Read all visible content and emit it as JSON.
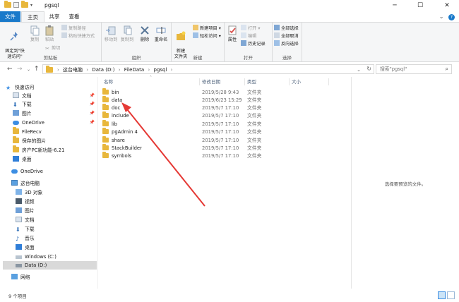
{
  "window": {
    "title": "pgsql",
    "controls": {
      "minimize": "─",
      "maximize": "☐",
      "close": "✕"
    }
  },
  "ribbon_tabs": [
    "文件",
    "主页",
    "共享",
    "查看"
  ],
  "ribbon": {
    "clipboard": {
      "label": "剪贴板",
      "pin_quick": "固定到\"快\n速访问\"",
      "copy": "复制",
      "paste": "粘贴",
      "copy_path": "复制路径",
      "paste_shortcut": "粘贴快捷方式",
      "cut": "剪切"
    },
    "organize": {
      "label": "组织",
      "move_to": "移动到",
      "copy_to": "复制到",
      "delete": "删除",
      "rename": "重命名"
    },
    "new": {
      "label": "新建",
      "new_folder": "新建\n文件夹",
      "new_item": "新建项目 ▾",
      "easy_access": "轻松访问 ▾"
    },
    "open": {
      "label": "打开",
      "properties": "属性",
      "open": "打开 ▾",
      "edit": "编辑",
      "history": "历史记录"
    },
    "select": {
      "label": "选择",
      "select_all": "全部选择",
      "select_none": "全部取消",
      "invert": "反向选择"
    }
  },
  "address": {
    "breadcrumbs": [
      "这台电脑",
      "Data (D:)",
      "FileData",
      "pgsql"
    ],
    "search_placeholder": "搜索\"pgsql\""
  },
  "navpane": {
    "quick_access": "快速访问",
    "quick_items": [
      {
        "label": "文档",
        "pinned": true
      },
      {
        "label": "下载",
        "pinned": true
      },
      {
        "label": "图片",
        "pinned": true
      },
      {
        "label": "OneDrive",
        "pinned": true
      },
      {
        "label": "FileRecv"
      },
      {
        "label": "保存的图片"
      },
      {
        "label": "房产PC新功能-6.21"
      },
      {
        "label": "桌面"
      }
    ],
    "onedrive": "OneDrive",
    "this_pc": "这台电脑",
    "pc_items": [
      "3D 对象",
      "视频",
      "图片",
      "文档",
      "下载",
      "音乐",
      "桌面",
      "Windows (C:)",
      "Data (D:)"
    ],
    "network": "网络"
  },
  "filelist": {
    "columns": {
      "name": "名称",
      "date": "修改日期",
      "type": "类型",
      "size": "大小"
    },
    "rows": [
      {
        "name": "bin",
        "date": "2019/5/28 9:43",
        "type": "文件夹"
      },
      {
        "name": "data",
        "date": "2019/6/23 15:29",
        "type": "文件夹"
      },
      {
        "name": "doc",
        "date": "2019/5/7 17:10",
        "type": "文件夹"
      },
      {
        "name": "include",
        "date": "2019/5/7 17:10",
        "type": "文件夹"
      },
      {
        "name": "lib",
        "date": "2019/5/7 17:10",
        "type": "文件夹"
      },
      {
        "name": "pgAdmin 4",
        "date": "2019/5/7 17:10",
        "type": "文件夹"
      },
      {
        "name": "share",
        "date": "2019/5/7 17:10",
        "type": "文件夹"
      },
      {
        "name": "StackBuilder",
        "date": "2019/5/7 17:10",
        "type": "文件夹"
      },
      {
        "name": "symbols",
        "date": "2019/5/7 17:10",
        "type": "文件夹"
      }
    ]
  },
  "preview": {
    "empty_text": "选择要预览的文件。"
  },
  "status": {
    "count": "9 个项目"
  },
  "colors": {
    "accent": "#1979ca",
    "folder": "#e8b73c",
    "annotation_arrow": "#e53935"
  }
}
